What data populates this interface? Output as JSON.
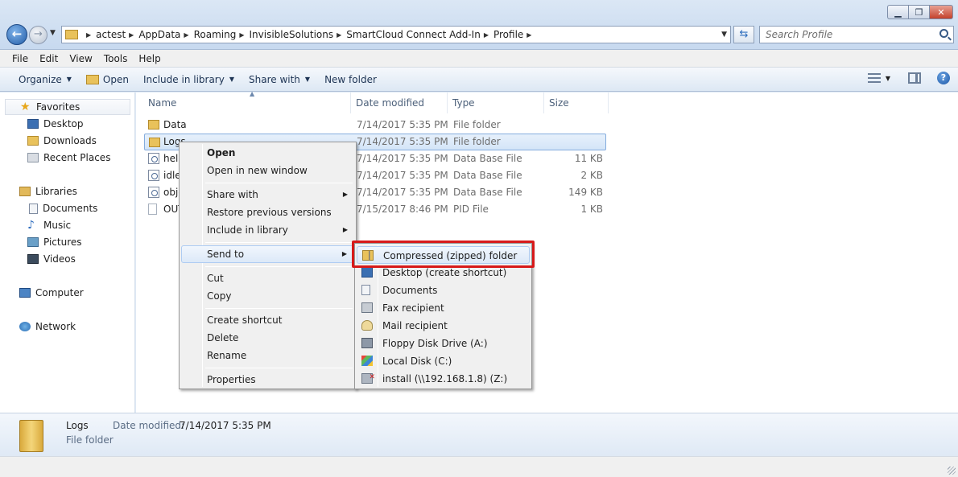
{
  "address": {
    "crumbs": [
      "actest",
      "AppData",
      "Roaming",
      "InvisibleSolutions",
      "SmartCloud Connect Add-In",
      "Profile"
    ]
  },
  "search": {
    "placeholder": "Search Profile"
  },
  "menubar": [
    "File",
    "Edit",
    "View",
    "Tools",
    "Help"
  ],
  "commands": {
    "organize": "Organize",
    "open": "Open",
    "include_in_library": "Include in library",
    "share_with": "Share with",
    "new_folder": "New folder"
  },
  "navpane": {
    "favorites": "Favorites",
    "favorites_items": [
      "Desktop",
      "Downloads",
      "Recent Places"
    ],
    "libraries": "Libraries",
    "libraries_items": [
      "Documents",
      "Music",
      "Pictures",
      "Videos"
    ],
    "computer": "Computer",
    "network": "Network"
  },
  "columns": {
    "name": "Name",
    "date_modified": "Date modified",
    "type": "Type",
    "size": "Size"
  },
  "files": [
    {
      "name": "Data",
      "date": "7/14/2017 5:35 PM",
      "type": "File folder",
      "size": ""
    },
    {
      "name": "Logs",
      "date": "7/14/2017 5:35 PM",
      "type": "File folder",
      "size": ""
    },
    {
      "name": "help",
      "date": "7/14/2017 5:35 PM",
      "type": "Data Base File",
      "size": "11 KB"
    },
    {
      "name": "idle",
      "date": "7/14/2017 5:35 PM",
      "type": "Data Base File",
      "size": "2 KB"
    },
    {
      "name": "obje",
      "date": "7/14/2017 5:35 PM",
      "type": "Data Base File",
      "size": "149 KB"
    },
    {
      "name": "OUT",
      "date": "7/15/2017 8:46 PM",
      "type": "PID File",
      "size": "1 KB"
    }
  ],
  "context_menu": {
    "open": "Open",
    "open_new_window": "Open in new window",
    "share_with": "Share with",
    "restore_previous": "Restore previous versions",
    "include_in_library": "Include in library",
    "send_to": "Send to",
    "cut": "Cut",
    "copy": "Copy",
    "create_shortcut": "Create shortcut",
    "delete": "Delete",
    "rename": "Rename",
    "properties": "Properties"
  },
  "send_to_menu": [
    "Compressed (zipped) folder",
    "Desktop (create shortcut)",
    "Documents",
    "Fax recipient",
    "Mail recipient",
    "Floppy Disk Drive (A:)",
    "Local Disk (C:)",
    "install (\\\\192.168.1.8) (Z:)"
  ],
  "details": {
    "name": "Logs",
    "date_label": "Date modified:",
    "date_value": "7/14/2017 5:35 PM",
    "type": "File folder"
  },
  "colors": {
    "highlight": "#d71a1a",
    "selection": "#d4e5f8"
  }
}
